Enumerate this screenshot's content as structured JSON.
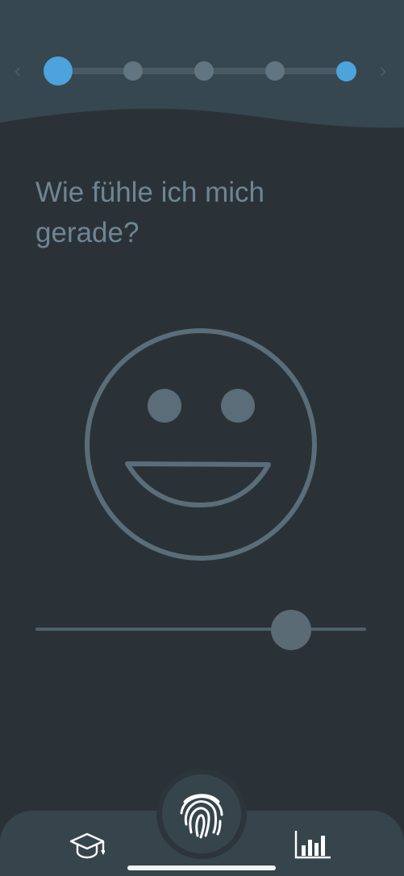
{
  "stepper": {
    "prev_icon": "chevron-left-icon",
    "next_icon": "chevron-right-icon",
    "step_count": 5,
    "current_step": 1,
    "active_color": "#4da3dc",
    "inactive_color": "#617681"
  },
  "main": {
    "question": "Wie fühle ich mich gerade?",
    "mood_icon": "smiley-face-icon",
    "mood_slider_value": 0.773
  },
  "tabbar": {
    "learn_icon": "graduation-cap-icon",
    "center_icon": "fingerprint-icon",
    "stats_icon": "bar-chart-icon"
  },
  "colors": {
    "background": "#2a3238",
    "header": "#37474f",
    "text": "#6f8592",
    "face_stroke": "#5a6d78"
  }
}
